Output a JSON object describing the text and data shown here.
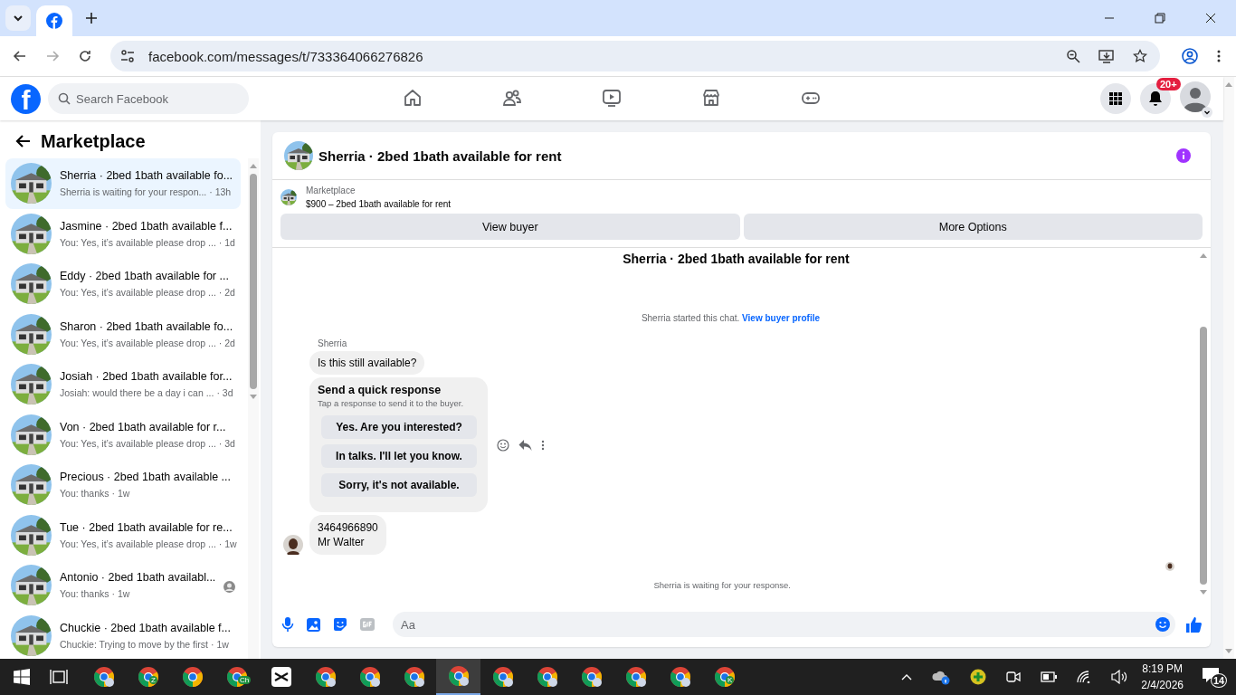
{
  "browser": {
    "url": "facebook.com/messages/t/733364066276826"
  },
  "header": {
    "logo_letter": "f",
    "search_placeholder": "Search Facebook",
    "nav": [
      {
        "kind": "home",
        "selected": false
      },
      {
        "kind": "friends",
        "selected": false
      },
      {
        "kind": "video",
        "selected": false
      },
      {
        "kind": "marketplace",
        "selected": false
      },
      {
        "kind": "gaming",
        "selected": false
      }
    ],
    "notification_badge": "20+"
  },
  "sidebar": {
    "title": "Marketplace",
    "items": [
      {
        "title": "Sherria · 2bed 1bath available fo...",
        "preview": "Sherria is waiting for your respon...",
        "time": "· 13h",
        "selected": true,
        "seen": false
      },
      {
        "title": "Jasmine · 2bed 1bath available f...",
        "preview": "You: Yes, it’s available please drop ...",
        "time": "· 1d",
        "selected": false,
        "seen": false
      },
      {
        "title": "Eddy · 2bed 1bath available for ...",
        "preview": "You: Yes, it’s available please drop ...",
        "time": "· 2d",
        "selected": false,
        "seen": false
      },
      {
        "title": "Sharon · 2bed 1bath available fo...",
        "preview": "You: Yes, it’s available please drop ...",
        "time": "· 2d",
        "selected": false,
        "seen": false
      },
      {
        "title": "Josiah · 2bed 1bath available for...",
        "preview": "Josiah: would there be a day i can ...",
        "time": "· 3d",
        "selected": false,
        "seen": false
      },
      {
        "title": "Von · 2bed 1bath available for r...",
        "preview": "You: Yes, it’s available please drop ...",
        "time": "· 3d",
        "selected": false,
        "seen": false
      },
      {
        "title": "Precious · 2bed 1bath available ...",
        "preview": "You: thanks",
        "time": "· 1w",
        "selected": false,
        "seen": false
      },
      {
        "title": "Tue · 2bed 1bath available for re...",
        "preview": "You: Yes, it’s available please drop ...",
        "time": "· 1w",
        "selected": false,
        "seen": false
      },
      {
        "title": "Antonio · 2bed 1bath availabl...",
        "preview": "You: thanks",
        "time": "· 1w",
        "selected": false,
        "seen": true
      },
      {
        "title": "Chuckie · 2bed 1bath available f...",
        "preview": "Chuckie: Trying to move by the first",
        "time": "· 1w",
        "selected": false,
        "seen": false
      }
    ]
  },
  "chat": {
    "title": "Sherria · 2bed 1bath available for rent",
    "listing": {
      "label": "Marketplace",
      "text": "$900 – 2bed 1bath available for rent"
    },
    "buttons": [
      "View buyer",
      "More Options"
    ],
    "thread_title": "Sherria · 2bed 1bath available for rent",
    "started": {
      "text": "Sherria started this chat.",
      "link": "View buyer profile"
    },
    "sender": "Sherria",
    "message": "Is this still available?",
    "quick_response": {
      "title": "Send a quick response",
      "subtitle": "Tap a response to send it to the buyer.",
      "options": [
        "Yes. Are you interested?",
        "In talks. I'll let you know.",
        "Sorry, it's not available."
      ]
    },
    "reply_lines": [
      "3464966890",
      "Mr Walter"
    ],
    "status": "Sherria is waiting for your response.",
    "composer": {
      "placeholder": "Aa"
    }
  },
  "taskbar": {
    "apps": [
      {
        "kind": "chrome-person",
        "selected": false
      },
      {
        "kind": "chrome-letter",
        "badge": "Z",
        "selected": false
      },
      {
        "kind": "chrome",
        "selected": false
      },
      {
        "kind": "chrome-letter",
        "badge": "Ch",
        "selected": false
      },
      {
        "kind": "capcut",
        "selected": false
      },
      {
        "kind": "chrome-person",
        "selected": false
      },
      {
        "kind": "chrome-person",
        "selected": false
      },
      {
        "kind": "chrome-person",
        "selected": false
      },
      {
        "kind": "chrome-person",
        "selected": true
      },
      {
        "kind": "chrome-person",
        "selected": false
      },
      {
        "kind": "chrome-person",
        "selected": false
      },
      {
        "kind": "chrome-person",
        "selected": false
      },
      {
        "kind": "chrome-person",
        "selected": false
      },
      {
        "kind": "chrome-person",
        "selected": false
      },
      {
        "kind": "chrome-letter",
        "badge": "K",
        "selected": false
      }
    ],
    "time": "8:19 PM",
    "date": "2/4/2026",
    "notifications": "14"
  }
}
